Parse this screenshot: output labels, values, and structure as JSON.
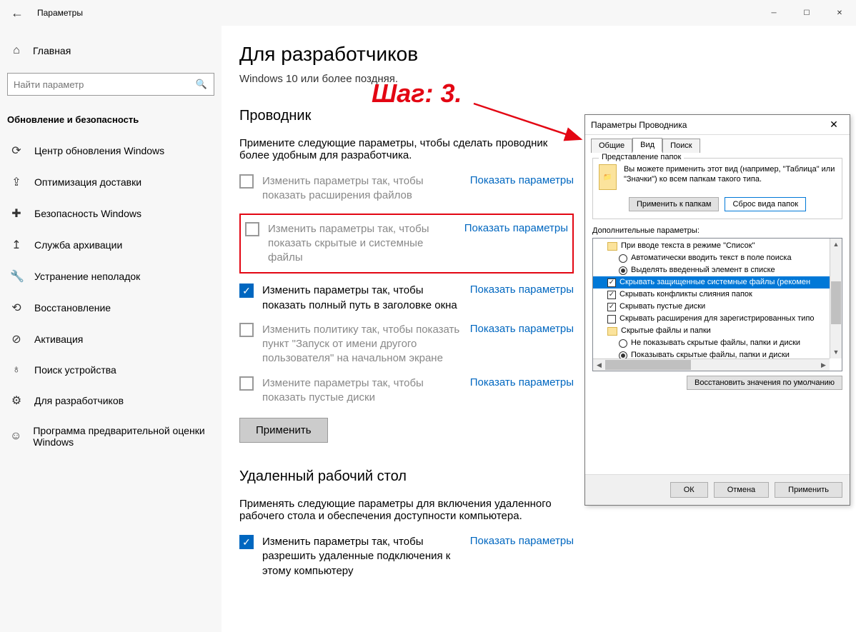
{
  "titlebar": {
    "title": "Параметры"
  },
  "sidebar": {
    "home": "Главная",
    "search_placeholder": "Найти параметр",
    "category": "Обновление и безопасность",
    "items": [
      "Центр обновления Windows",
      "Оптимизация доставки",
      "Безопасность Windows",
      "Служба архивации",
      "Устранение неполадок",
      "Восстановление",
      "Активация",
      "Поиск устройства",
      "Для разработчиков",
      "Программа предварительной оценки Windows"
    ]
  },
  "main": {
    "title": "Для разработчиков",
    "subtitle": "Windows 10 или более поздняя.",
    "explorer": {
      "header": "Проводник",
      "desc": "Примените следующие параметры, чтобы сделать проводник более удобным для разработчика.",
      "items": [
        {
          "text": "Изменить параметры так, чтобы показать расширения файлов",
          "checked": false,
          "active": false
        },
        {
          "text": "Изменить параметры так, чтобы показать скрытые и системные файлы",
          "checked": false,
          "active": false
        },
        {
          "text": "Изменить параметры так, чтобы показать полный путь в заголовке окна",
          "checked": true,
          "active": true
        },
        {
          "text": "Изменить политику так, чтобы показать пункт \"Запуск от имени другого пользователя\" на начальном экране",
          "checked": false,
          "active": false
        },
        {
          "text": "Измените параметры так, чтобы показать пустые диски",
          "checked": false,
          "active": false
        }
      ],
      "link": "Показать параметры",
      "apply": "Применить"
    },
    "rdp": {
      "header": "Удаленный рабочий стол",
      "desc": "Применять следующие параметры для включения удаленного рабочего стола и обеспечения доступности компьютера.",
      "item": {
        "text": "Изменить параметры так, чтобы разрешить удаленные подключения к этому компьютеру",
        "checked": true
      }
    }
  },
  "step_label": "Шаг: 3.",
  "dialog": {
    "title": "Параметры Проводника",
    "tabs": [
      "Общие",
      "Вид",
      "Поиск"
    ],
    "folder_view": {
      "legend": "Представление папок",
      "text": "Вы можете применить этот вид (например, \"Таблица\" или \"Значки\") ко всем папкам такого типа.",
      "btn_apply": "Применить к папкам",
      "btn_reset": "Сброс вида папок"
    },
    "advanced_label": "Дополнительные параметры:",
    "tree": [
      {
        "type": "folder",
        "lvl": 1,
        "text": "При вводе текста в режиме \"Список\""
      },
      {
        "type": "radio",
        "lvl": 2,
        "sel": false,
        "text": "Автоматически вводить текст в поле поиска"
      },
      {
        "type": "radio",
        "lvl": 2,
        "sel": true,
        "text": "Выделять введенный элемент в списке"
      },
      {
        "type": "check",
        "lvl": 1,
        "sel": true,
        "hl": true,
        "text": "Скрывать защищенные системные файлы (рекомен"
      },
      {
        "type": "check",
        "lvl": 1,
        "sel": true,
        "text": "Скрывать конфликты слияния папок"
      },
      {
        "type": "check",
        "lvl": 1,
        "sel": true,
        "text": "Скрывать пустые диски"
      },
      {
        "type": "check",
        "lvl": 1,
        "sel": false,
        "text": "Скрывать расширения для зарегистрированных типо"
      },
      {
        "type": "folder",
        "lvl": 1,
        "text": "Скрытые файлы и папки"
      },
      {
        "type": "radio",
        "lvl": 2,
        "sel": false,
        "text": "Не показывать скрытые файлы, папки и диски"
      },
      {
        "type": "radio",
        "lvl": 2,
        "sel": true,
        "text": "Показывать скрытые файлы, папки и диски"
      }
    ],
    "restore": "Восстановить значения по умолчанию",
    "footer": {
      "ok": "ОК",
      "cancel": "Отмена",
      "apply": "Применить"
    }
  }
}
